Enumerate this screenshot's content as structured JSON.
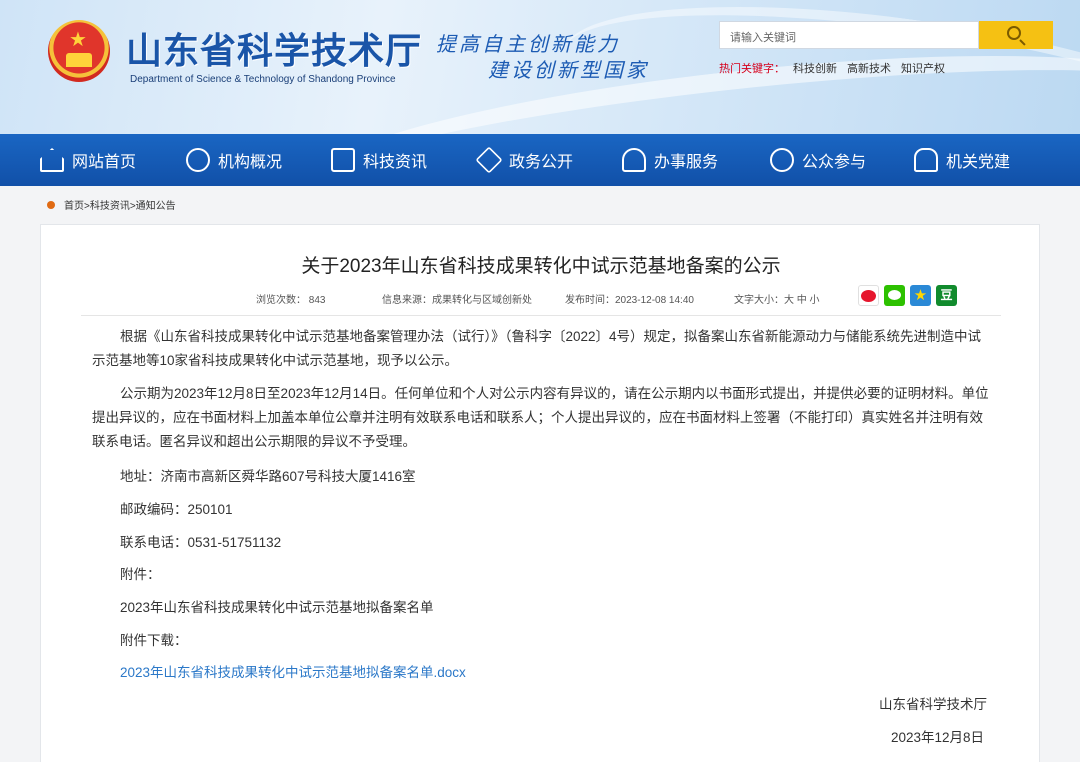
{
  "header": {
    "site_title": "山东省科学技术厅",
    "site_subtitle": "Department of Science & Technology of Shandong Province",
    "slogan_line1": "提高自主创新能力",
    "slogan_line2": "建设创新型国家",
    "search_placeholder": "请输入关键词",
    "hot_label": "热门关键字：",
    "hot_words": [
      "科技创新",
      "高新技术",
      "知识产权"
    ]
  },
  "nav": {
    "items": [
      {
        "label": "网站首页",
        "icon": "home-icon"
      },
      {
        "label": "机构概况",
        "icon": "atom-icon"
      },
      {
        "label": "科技资讯",
        "icon": "news-icon"
      },
      {
        "label": "政务公开",
        "icon": "layers-icon"
      },
      {
        "label": "办事服务",
        "icon": "user-service-icon"
      },
      {
        "label": "公众参与",
        "icon": "people-icon"
      },
      {
        "label": "机关党建",
        "icon": "party-icon"
      }
    ]
  },
  "breadcrumb": "首页>科技资讯>通知公告",
  "article": {
    "title": "关于2023年山东省科技成果转化中试示范基地备案的公示",
    "views": "浏览次数：  843",
    "source": "信息来源：成果转化与区域创新处",
    "published": "发布时间：2023-12-08 14:40",
    "font_size": "文字大小：大 中 小",
    "share_icons": [
      "weibo-icon",
      "wechat-icon",
      "qzone-icon",
      "douban-icon"
    ],
    "douban_label": "豆",
    "paragraph1": "根据《山东省科技成果转化中试示范基地备案管理办法（试行）》（鲁科字〔2022〕4号）规定，拟备案山东省新能源动力与储能系统先进制造中试示范基地等10家省科技成果转化中试示范基地，现予以公示。",
    "paragraph2": "公示期为2023年12月8日至2023年12月14日。任何单位和个人对公示内容有异议的，请在公示期内以书面形式提出，并提供必要的证明材料。单位提出异议的，应在书面材料上加盖本单位公章并注明有效联系电话和联系人；个人提出异议的，应在书面材料上签署（不能打印）真实姓名并注明有效联系电话。匿名异议和超出公示期限的异议不予受理。",
    "address": "地址：济南市高新区舜华路607号科技大厦1416室",
    "postcode": "邮政编码：250101",
    "phone": "联系电话：0531-51751132",
    "attachment_label": "附件：",
    "attachment_name": "2023年山东省科技成果转化中试示范基地拟备案名单",
    "download_label": "附件下载：",
    "download_link": "2023年山东省科技成果转化中试示范基地拟备案名单.docx",
    "signature": "山东省科学技术厅",
    "sign_date": "2023年12月8日"
  }
}
